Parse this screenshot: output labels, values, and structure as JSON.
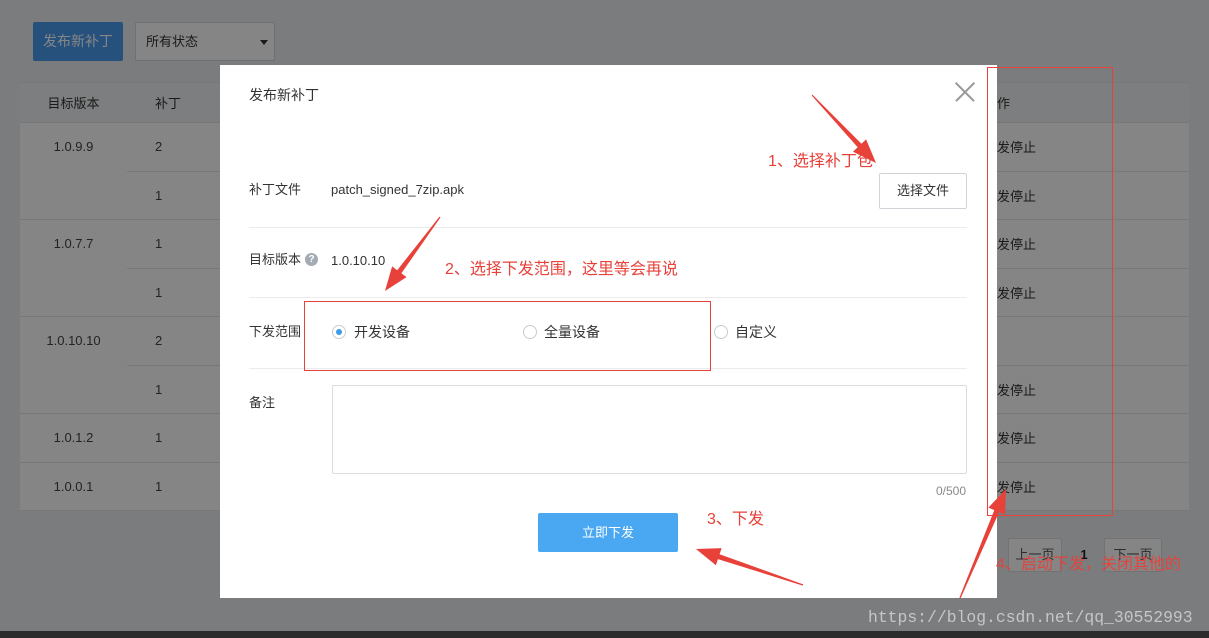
{
  "colors": {
    "primary": "#4aa8f2",
    "brand": "#4a9cf0",
    "radio_checked": "#3d9be9",
    "annotation": "#e8413a"
  },
  "page": {
    "publish_button": "发布新补丁",
    "status_filter": {
      "selected": "所有状态",
      "icon": "caret-down-icon"
    },
    "table": {
      "headers": {
        "version": "目标版本",
        "patch": "补丁",
        "action": "作"
      },
      "rows": [
        {
          "version": "1.0.9.9",
          "patch": "2",
          "action": "发停止"
        },
        {
          "version": "",
          "patch": "1",
          "action": "发停止"
        },
        {
          "version": "1.0.7.7",
          "patch": "1",
          "action": "发停止"
        },
        {
          "version": "",
          "patch": "1",
          "action": "发停止"
        },
        {
          "version": "1.0.10.10",
          "patch": "2",
          "action": ""
        },
        {
          "version": "",
          "patch": "1",
          "action": "发停止"
        },
        {
          "version": "1.0.1.2",
          "patch": "1",
          "action": "发停止"
        },
        {
          "version": "1.0.0.1",
          "patch": "1",
          "action": "发停止"
        }
      ]
    },
    "pagination": {
      "prev": "上一页",
      "current": "1",
      "next": "下一页"
    }
  },
  "modal": {
    "title": "发布新补丁",
    "close_icon": "close-icon",
    "patch_file": {
      "label": "补丁文件",
      "value": "patch_signed_7zip.apk",
      "button": "选择文件"
    },
    "target_version": {
      "label": "目标版本",
      "value": "1.0.10.10",
      "help_icon": "question-circle-icon"
    },
    "scope": {
      "label": "下发范围",
      "options": [
        {
          "label": "开发设备",
          "checked": true
        },
        {
          "label": "全量设备",
          "checked": false
        },
        {
          "label": "自定义",
          "checked": false
        }
      ]
    },
    "remark": {
      "label": "备注",
      "value": "",
      "counter": "0/500"
    },
    "submit": "立即下发"
  },
  "annotations": {
    "step1": "1、选择补丁包",
    "step2": "2、选择下发范围，这里等会再说",
    "step3": "3、下发",
    "step4": "4、启动下发，关闭其他的"
  },
  "watermark": "https://blog.csdn.net/qq_30552993"
}
